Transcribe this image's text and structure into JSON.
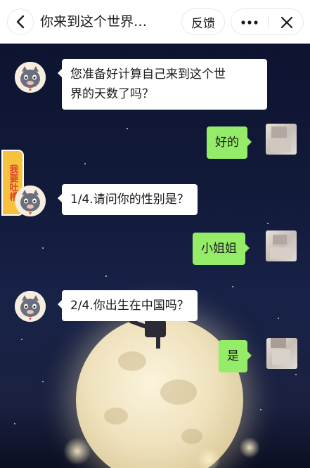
{
  "header": {
    "title": "你来到这个世界…",
    "feedback_label": "反馈",
    "back_icon": "chevron-left-icon",
    "more_icon": "ellipsis-icon",
    "close_icon": "close-icon"
  },
  "side_tab": {
    "label": "我要吐槽"
  },
  "messages": [
    {
      "from": "bot",
      "text_line1": "您准备好计算自己来到这个世",
      "text_line2": "界的天数了吗？"
    },
    {
      "from": "user",
      "text": "好的"
    },
    {
      "from": "bot",
      "text": "1/4.请问你的性别是？"
    },
    {
      "from": "user",
      "text": "小姐姐"
    },
    {
      "from": "bot",
      "text": "2/4.你出生在中国吗？"
    },
    {
      "from": "user",
      "text": "是"
    }
  ],
  "colors": {
    "user_bubble": "#95ec69",
    "bot_bubble": "#ffffff",
    "side_tab": "#f6c23e",
    "side_tab_text": "#e0452b"
  }
}
